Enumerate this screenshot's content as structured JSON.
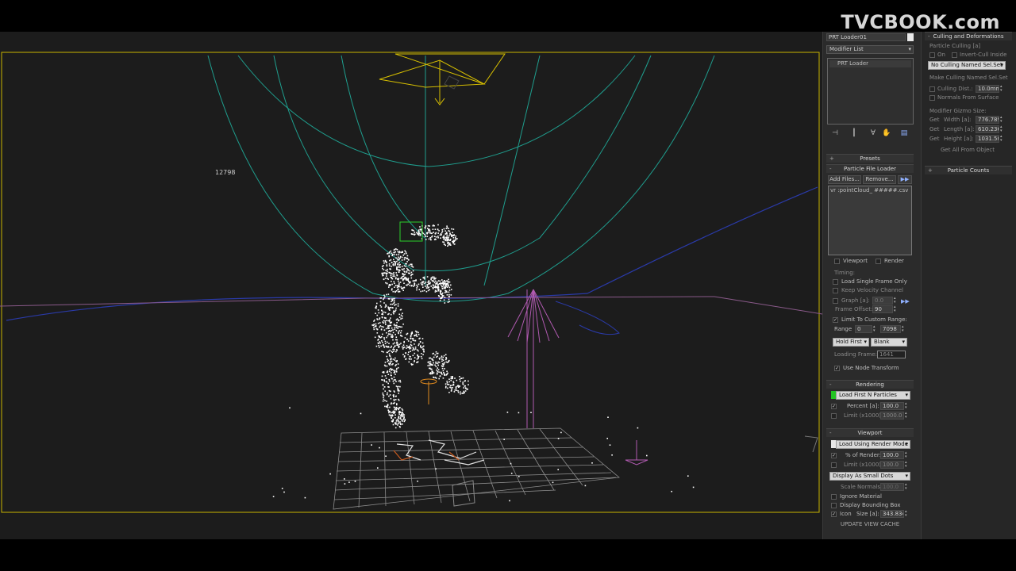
{
  "watermark": "TVCBOOK.com",
  "viewport": {
    "counter": "12798"
  },
  "modify_panel": {
    "object_name": "PRT Loader01",
    "modifier_list": "Modifier List",
    "stack_item": "PRT Loader",
    "presets": "Presets",
    "particle_file_loader": {
      "title": "Particle File Loader",
      "add_files": "Add Files...",
      "remove": "Remove...",
      "file_path": "vr :pointCloud_ #####.csv",
      "viewport_label": "Viewport",
      "render_label": "Render"
    },
    "timing": {
      "title": "Timing:",
      "load_single_frame": "Load Single Frame Only",
      "keep_velocity": "Keep Velocity Channel",
      "graph_label": "Graph [a]:",
      "graph_value": "0.0",
      "frame_offset_label": "Frame Offset:",
      "frame_offset_value": "90",
      "limit_range": "Limit To Custom Range:",
      "range_label": "Range",
      "range_start": "0",
      "range_end": "7098",
      "hold_first": "Hold First",
      "blank": "Blank",
      "loading_frame_label": "Loading Frame:",
      "loading_frame_value": "1641",
      "use_node_transform": "Use Node Transform"
    },
    "rendering": {
      "title": "Rendering",
      "mode": "Load First N Particles",
      "percent_label": "Percent [a]:",
      "percent_value": "100.0",
      "limit_label": "Limit (x1000):",
      "limit_value": "1000.0"
    },
    "viewport_rollout": {
      "title": "Viewport",
      "mode": "Load Using Render Mode",
      "pct_render_label": "% of Render:",
      "pct_render_value": "100.0",
      "limit_label": "Limit (x1000):",
      "limit_value": "100.0",
      "display_mode": "Display As Small Dots",
      "scale_normals_label": "Scale Normals:",
      "scale_normals_value": "100.0",
      "ignore_material": "Ignore Material",
      "display_bbox": "Display Bounding Box",
      "icon_label": "Icon",
      "size_label": "Size [a]:",
      "size_value": "343.834",
      "update_cache": "UPDATE VIEW CACHE"
    }
  },
  "right_panel": {
    "culling_title": "Culling and Deformations",
    "particle_culling": "Particle Culling [a]",
    "on_label": "On",
    "invert_cull": "Invert-Cull Inside",
    "named_sel": "No Culling Named Sel.Set",
    "make_named_sel": "Make Culling Named Sel.Set",
    "culling_dist_label": "Culling Dist.:",
    "culling_dist_value": "10.0mm",
    "normals_from_surface": "Normals From Surface",
    "gizmo_size": "Modifier Gizmo Size:",
    "get": "Get",
    "width_label": "Width [a]:",
    "width_value": "776.789",
    "length_label": "Length [a]:",
    "length_value": "610.236",
    "height_label": "Height [a]:",
    "height_value": "1031.50",
    "get_all": "Get All From Object",
    "particle_counts": "Particle Counts"
  },
  "colors": {
    "viewport_bg": "#1c1c1c",
    "selection_frame": "#c8b400",
    "panel_bg": "#2b2b2b",
    "green_swatch": "#22c422"
  }
}
